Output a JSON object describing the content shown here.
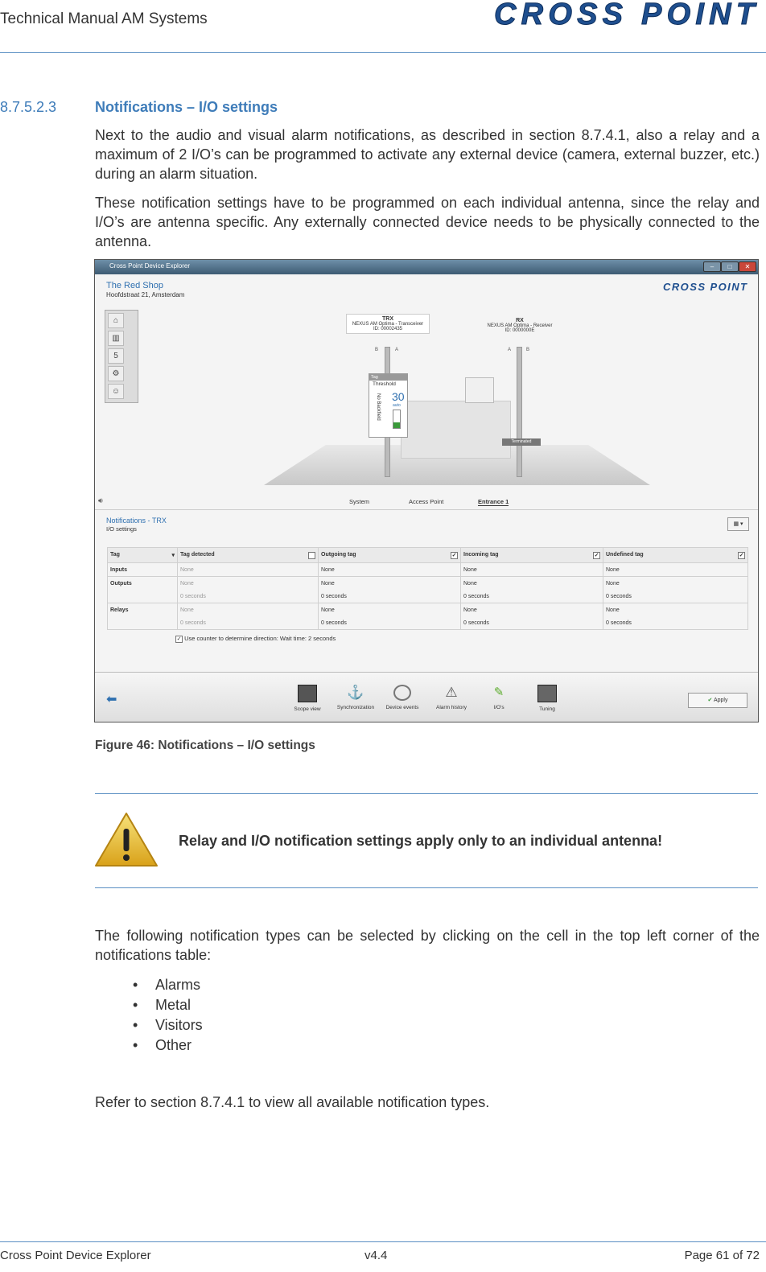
{
  "header": {
    "title": "Technical Manual AM Systems",
    "logo_text": "CROSS POINT"
  },
  "section": {
    "number": "8.7.5.2.3",
    "title": "Notifications – I/O settings"
  },
  "paragraphs": [
    "Next to the audio and visual alarm notifications, as described in section 8.7.4.1, also a relay and a maximum of 2 I/O’s can be programmed to activate any external device (camera, external buzzer, etc.) during an alarm situation.",
    "These notification settings have to be programmed on each individual antenna, since the relay and I/O’s are antenna specific. Any externally connected device needs to be physically connected to the antenna."
  ],
  "screenshot": {
    "window_title": "Cross Point Device Explorer",
    "shop_name": "The Red Shop",
    "shop_address": "Hoofdstraat 21, Amsterdam",
    "app_logo": "CROSS POINT",
    "antennas": [
      {
        "name": "TRX",
        "model": "NEXUS AM Optima - Transceiver",
        "id": "ID: 00002435"
      },
      {
        "name": "RX",
        "model": "NEXUS AM Optima - Receiver",
        "id": "ID: 0000000E"
      }
    ],
    "antenna_labels": {
      "b": "B",
      "a": "A"
    },
    "threshold": {
      "tag": "Tag",
      "label": "Threshold",
      "value": "30",
      "mode": "auto",
      "vertical": "No Backfield"
    },
    "terminated_label": "Terminated",
    "tabs": [
      "System",
      "Access Point",
      "Entrance 1"
    ],
    "notif_title": "Notifications - TRX",
    "notif_sub": "I/O settings",
    "table": {
      "headers": [
        "Tag",
        "Tag detected",
        "Outgoing tag",
        "Incoming tag",
        "Undefined tag"
      ],
      "rows": [
        {
          "label": "Inputs",
          "cells": [
            "None",
            "None",
            "None",
            "None"
          ]
        },
        {
          "label": "Outputs",
          "cells": [
            "None",
            "None",
            "None",
            "None"
          ]
        },
        {
          "label": "",
          "cells": [
            "0 seconds",
            "0 seconds",
            "0 seconds",
            "0 seconds"
          ]
        },
        {
          "label": "Relays",
          "cells": [
            "None",
            "None",
            "None",
            "None"
          ]
        },
        {
          "label": "",
          "cells": [
            "0 seconds",
            "0 seconds",
            "0 seconds",
            "0 seconds"
          ]
        }
      ]
    },
    "counter_text": "Use counter to determine direction: Wait time: 2 seconds",
    "bottom_items": [
      "Scope view",
      "Synchronization",
      "Device events",
      "Alarm history",
      "I/O's",
      "Tuning"
    ],
    "apply_label": "Apply"
  },
  "caption": "Figure 46: Notifications – I/O settings",
  "note": "Relay and I/O notification settings apply only to an individual antenna!",
  "paragraph3": "The following notification types can be selected by clicking on the cell in the top left corner of the notifications table:",
  "bullets": [
    "Alarms",
    "Metal",
    "Visitors",
    "Other"
  ],
  "paragraph4": "Refer to section 8.7.4.1 to view all available notification types.",
  "footer": {
    "left": "Cross Point Device Explorer",
    "center": "v4.4",
    "right": "Page 61 of 72"
  }
}
